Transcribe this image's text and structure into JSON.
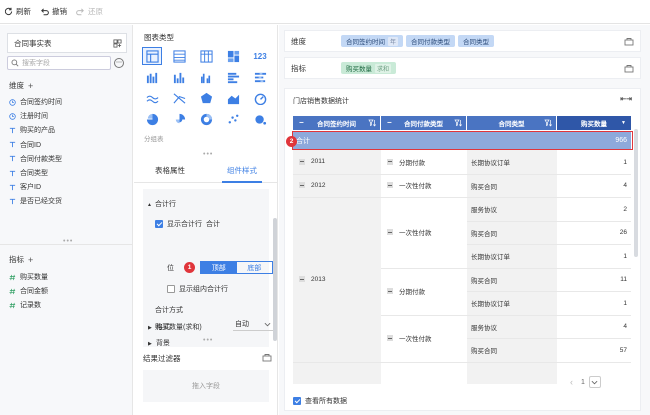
{
  "toolbar": {
    "refresh": "刷新",
    "undo": "撤销",
    "redo": "还原"
  },
  "left": {
    "dataset": "合同事实表",
    "search_placeholder": "搜索字段",
    "dimension_title": "维度",
    "dimensions": [
      {
        "label": "合同签约时间",
        "icon": "clock-icon"
      },
      {
        "label": "注册时间",
        "icon": "clock-icon"
      },
      {
        "label": "购买的产品",
        "icon": "text-icon"
      },
      {
        "label": "合同ID",
        "icon": "text-icon"
      },
      {
        "label": "合同付款类型",
        "icon": "text-icon"
      },
      {
        "label": "合同类型",
        "icon": "text-icon"
      },
      {
        "label": "客户ID",
        "icon": "text-icon"
      },
      {
        "label": "是否已经交货",
        "icon": "text-icon"
      }
    ],
    "measure_title": "指标",
    "measures": [
      {
        "label": "购买数量",
        "icon": "number-icon"
      },
      {
        "label": "合同金额",
        "icon": "number-icon"
      },
      {
        "label": "记录数",
        "icon": "number-icon"
      }
    ]
  },
  "middle": {
    "chart_type_title": "图表类型",
    "group_label": "分组表",
    "tab_table": "表格属性",
    "tab_component": "组件样式",
    "subtotal_section": "合计行",
    "show_total": "显示合计行",
    "total_word": "合计",
    "position_label": "位",
    "pos_top": "顶部",
    "pos_bottom": "底部",
    "show_group_total": "显示组内合计行",
    "total_method": "合计方式",
    "measure_name": "购买数量(求和)",
    "method_value": "自动",
    "format": "格式",
    "background": "背景",
    "filter_title": "结果过滤器",
    "drop_hint": "拖入字段",
    "badge1": "1"
  },
  "right": {
    "dim_shelf": "维度",
    "dim_pills": [
      {
        "label": "合同签约时间",
        "tag": "年"
      },
      {
        "label": "合同付款类型",
        "tag": ""
      },
      {
        "label": "合同类型",
        "tag": ""
      }
    ],
    "measure_shelf": "指标",
    "measure_pill": {
      "label": "购买数量",
      "tag": "求和"
    },
    "table_title": "门店销售数据统计",
    "headers": [
      "合同签约时间",
      "合同付款类型",
      "合同类型",
      "购买数量"
    ],
    "total_label": "合计",
    "total_value": "966",
    "badge2": "2",
    "years": [
      "2011",
      "2012",
      "2013"
    ],
    "pay_types": [
      "分期付款",
      "一次性付款",
      "一次性付款",
      "分期付款",
      "一次性付款"
    ],
    "rows": [
      {
        "type": "长期协议订单",
        "qty": "1"
      },
      {
        "type": "购买合同",
        "qty": "4"
      },
      {
        "type": "服务协议",
        "qty": "2"
      },
      {
        "type": "购买合同",
        "qty": "26"
      },
      {
        "type": "长期协议订单",
        "qty": "1"
      },
      {
        "type": "购买合同",
        "qty": "11"
      },
      {
        "type": "长期协议订单",
        "qty": "1"
      },
      {
        "type": "服务协议",
        "qty": "4"
      },
      {
        "type": "购买合同",
        "qty": "57"
      }
    ],
    "page": "1",
    "view_all": "查看所有数据"
  }
}
